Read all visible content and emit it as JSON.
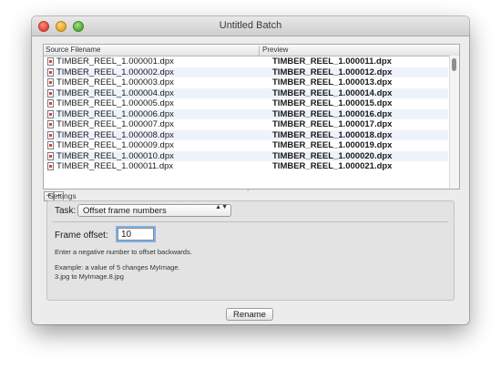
{
  "window": {
    "title": "Untitled Batch"
  },
  "table": {
    "headers": [
      "Source Filename",
      "Preview"
    ],
    "rows": [
      {
        "source": "TIMBER_REEL_1.000001.dpx",
        "preview": "TIMBER_REEL_1.000011.dpx"
      },
      {
        "source": "TIMBER_REEL_1.000002.dpx",
        "preview": "TIMBER_REEL_1.000012.dpx"
      },
      {
        "source": "TIMBER_REEL_1.000003.dpx",
        "preview": "TIMBER_REEL_1.000013.dpx"
      },
      {
        "source": "TIMBER_REEL_1.000004.dpx",
        "preview": "TIMBER_REEL_1.000014.dpx"
      },
      {
        "source": "TIMBER_REEL_1.000005.dpx",
        "preview": "TIMBER_REEL_1.000015.dpx"
      },
      {
        "source": "TIMBER_REEL_1.000006.dpx",
        "preview": "TIMBER_REEL_1.000016.dpx"
      },
      {
        "source": "TIMBER_REEL_1.000007.dpx",
        "preview": "TIMBER_REEL_1.000017.dpx"
      },
      {
        "source": "TIMBER_REEL_1.000008.dpx",
        "preview": "TIMBER_REEL_1.000018.dpx"
      },
      {
        "source": "TIMBER_REEL_1.000009.dpx",
        "preview": "TIMBER_REEL_1.000019.dpx"
      },
      {
        "source": "TIMBER_REEL_1.000010.dpx",
        "preview": "TIMBER_REEL_1.000020.dpx"
      },
      {
        "source": "TIMBER_REEL_1.000011.dpx",
        "preview": "TIMBER_REEL_1.000021.dpx"
      }
    ]
  },
  "controls": {
    "add": "+",
    "remove": "−",
    "split": "˰"
  },
  "settings": {
    "label": "Settings",
    "task_label": "Task:",
    "task_value": "Offset frame numbers",
    "updown": "▲▼",
    "offset_label": "Frame offset:",
    "offset_value": "10",
    "hint": "Enter a negative number to offset backwards.",
    "example_line1": "Example: a value of 5 changes MyImage.",
    "example_line2": "3.jpg to MyImage.8.jpg"
  },
  "rename_label": "Rename",
  "colors": {
    "selection_focus": "#7fb0e8",
    "row_alt": "#eef3fb"
  }
}
